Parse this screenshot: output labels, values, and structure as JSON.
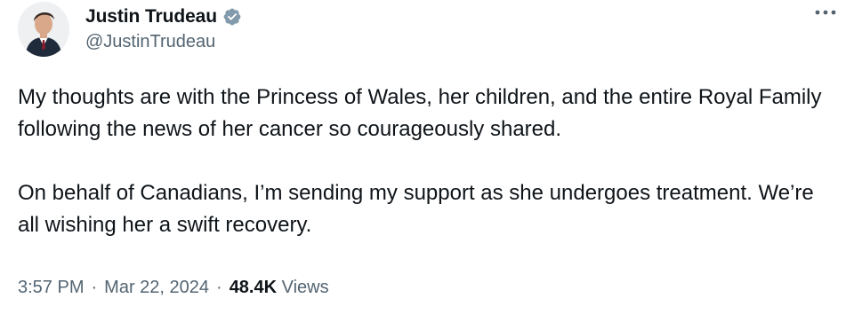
{
  "author": {
    "display_name": "Justin Trudeau",
    "handle": "@JustinTrudeau",
    "verified_icon": "verified-badge-icon",
    "avatar_icon": "avatar-photo"
  },
  "more_icon": "more-options-icon",
  "tweet": {
    "paragraphs": [
      "My thoughts are with the Princess of Wales, her children, and the entire Royal Family following the news of her cancer so courageously shared.",
      "On behalf of Canadians, I’m sending my support as she undergoes treatment. We’re all wishing her a swift recovery."
    ]
  },
  "meta": {
    "time": "3:57 PM",
    "separator": "·",
    "date": "Mar 22, 2024",
    "views_count": "48.4K",
    "views_label": "Views"
  },
  "colors": {
    "text_primary": "#0f1419",
    "text_secondary": "#536471",
    "verified_blue": "#829aab"
  }
}
